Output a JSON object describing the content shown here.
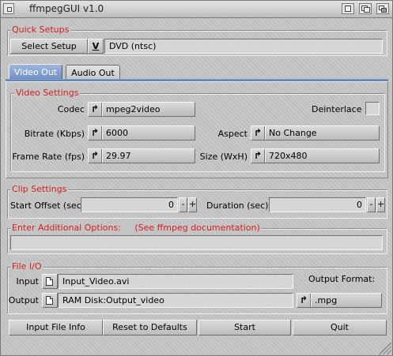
{
  "window": {
    "title": "ffmpegGUI  v1.0"
  },
  "quick_setups": {
    "title": "Quick Setups",
    "select_button": "Select Setup",
    "dropdown_glyph": "V",
    "current_setup": "DVD (ntsc)"
  },
  "tabs": [
    {
      "label": "Video Out",
      "active": true
    },
    {
      "label": "Audio Out",
      "active": false
    }
  ],
  "video_settings": {
    "title": "Video Settings",
    "codec_label": "Codec",
    "codec_value": "mpeg2video",
    "deinterlace_label": "Deinterlace",
    "deinterlace_checked": false,
    "bitrate_label": "Bitrate (Kbps)",
    "bitrate_value": "6000",
    "aspect_label": "Aspect",
    "aspect_value": "No Change",
    "framerate_label": "Frame Rate (fps)",
    "framerate_value": "29.97",
    "size_label": "Size (WxH)",
    "size_value": "720x480"
  },
  "clip_settings": {
    "title": "Clip Settings",
    "start_label": "Start Offset (sec)",
    "start_value": "0",
    "duration_label": "Duration (sec)",
    "duration_value": "0",
    "minus": "-",
    "plus": "+"
  },
  "additional_options": {
    "title": "Enter Additional Options:     (See ffmpeg documentation)",
    "value": ""
  },
  "file_io": {
    "title": "File I/O",
    "input_label": "Input",
    "input_value": "Input_Video.avi",
    "output_label": "Output",
    "output_value": "RAM Disk:Output_video",
    "output_format_label": "Output Format:",
    "output_format_value": ".mpg"
  },
  "buttons": {
    "input_file_info": "Input File Info",
    "reset_defaults": "Reset to Defaults",
    "start": "Start",
    "quit": "Quit"
  },
  "icons": {
    "cycle": "cycle-arrow-icon",
    "file": "file-icon"
  }
}
